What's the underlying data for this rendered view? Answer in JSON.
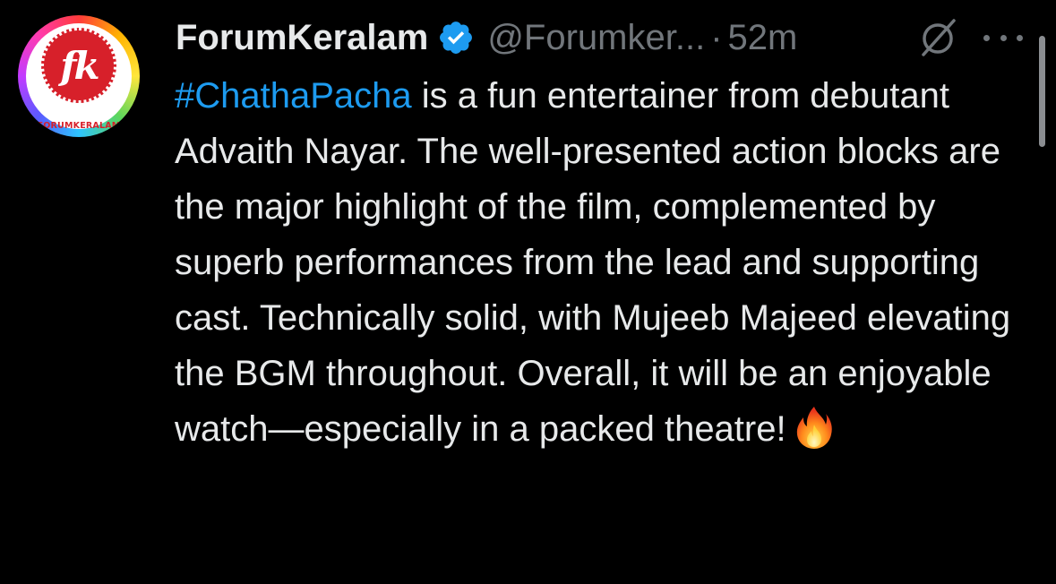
{
  "tweet": {
    "author": {
      "display_name": "ForumKeralam",
      "handle": "@Forumker...",
      "verified": true,
      "avatar_monogram": "fk",
      "avatar_brand": "FORUMKERALAM"
    },
    "separator": "·",
    "time": "52m",
    "icons": {
      "verified": "verified-badge-icon",
      "grok": "grok-icon",
      "more": "more-options-icon",
      "emoji": "fire-emoji-icon"
    },
    "body": {
      "hashtag": "#ChathaPacha",
      "text": " is a fun entertainer from debutant Advaith Nayar. The well-presented action blocks are the major highlight of the film, complemented by superb performances from the lead and supporting cast. Technically solid, with Mujeeb Majeed elevating the BGM throughout. Overall, it will be an enjoyable watch—especially in a packed theatre!"
    }
  },
  "colors": {
    "background": "#000000",
    "primary_text": "#e7e9ea",
    "secondary_text": "#71767b",
    "link": "#1d9bf0",
    "verified": "#1d9bf0"
  }
}
